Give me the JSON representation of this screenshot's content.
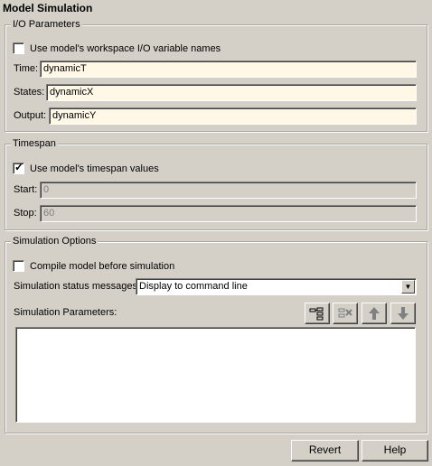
{
  "panel": {
    "title": "Model Simulation"
  },
  "io": {
    "group_label": "I/O Parameters",
    "use_workspace_label": "Use model's workspace I/O variable names",
    "use_workspace_checked": false,
    "time_label": "Time:",
    "time_value": "dynamicT",
    "states_label": "States:",
    "states_value": "dynamicX",
    "output_label": "Output:",
    "output_value": "dynamicY"
  },
  "timespan": {
    "group_label": "Timespan",
    "use_timespan_label": "Use model's timespan values",
    "use_timespan_checked": true,
    "start_label": "Start:",
    "start_value": "0",
    "stop_label": "Stop:",
    "stop_value": "60"
  },
  "sim": {
    "group_label": "Simulation Options",
    "compile_label": "Compile model before simulation",
    "compile_checked": false,
    "status_label": "Simulation status messages:",
    "status_value": "Display to command line",
    "params_label": "Simulation Parameters:",
    "toolbar_icons": [
      "add-parameter-icon",
      "delete-parameter-icon",
      "move-up-icon",
      "move-down-icon"
    ]
  },
  "buttons": {
    "revert": "Revert",
    "help": "Help"
  }
}
